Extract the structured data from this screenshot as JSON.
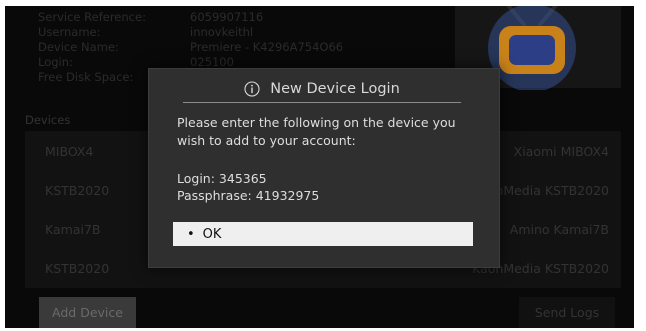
{
  "account": {
    "rows": [
      {
        "label": "Service Reference:",
        "value": "6059907116"
      },
      {
        "label": "Username:",
        "value": "innovkeithl"
      },
      {
        "label": "Device Name:",
        "value": "Premiere - K4296A754O66"
      },
      {
        "label": "Login:",
        "value": "025100"
      },
      {
        "label": "Free Disk Space:",
        "value": ""
      }
    ]
  },
  "devices": {
    "section_label": "Devices",
    "rows": [
      {
        "left": "MIBOX4",
        "right": "Xiaomi MIBOX4"
      },
      {
        "left": "KSTB2020",
        "right": "KaonMedia KSTB2020"
      },
      {
        "left": "Kamai7B",
        "right": "Amino Kamai7B"
      },
      {
        "left": "KSTB2020",
        "right": "KaonMedia KSTB2020"
      }
    ]
  },
  "buttons": {
    "add_device": "Add Device",
    "send_logs": "Send Logs"
  },
  "dialog": {
    "title": "New Device Login",
    "message": "Please enter the following on the device you wish to add to your account:",
    "login": "Login: 345365",
    "passphrase": "Passphrase: 41932975",
    "ok_label": "OK",
    "ok_bullet": "•"
  },
  "icons": {
    "dialog_icon": "info-icon",
    "logo_icon": "tv-icon"
  },
  "colors": {
    "screen_bg": "#090909",
    "dialog_bg": "#2f2f2f",
    "ok_bg": "#efefef",
    "tv_accent": "#c9821a",
    "tv_screen": "#2c3f86"
  }
}
